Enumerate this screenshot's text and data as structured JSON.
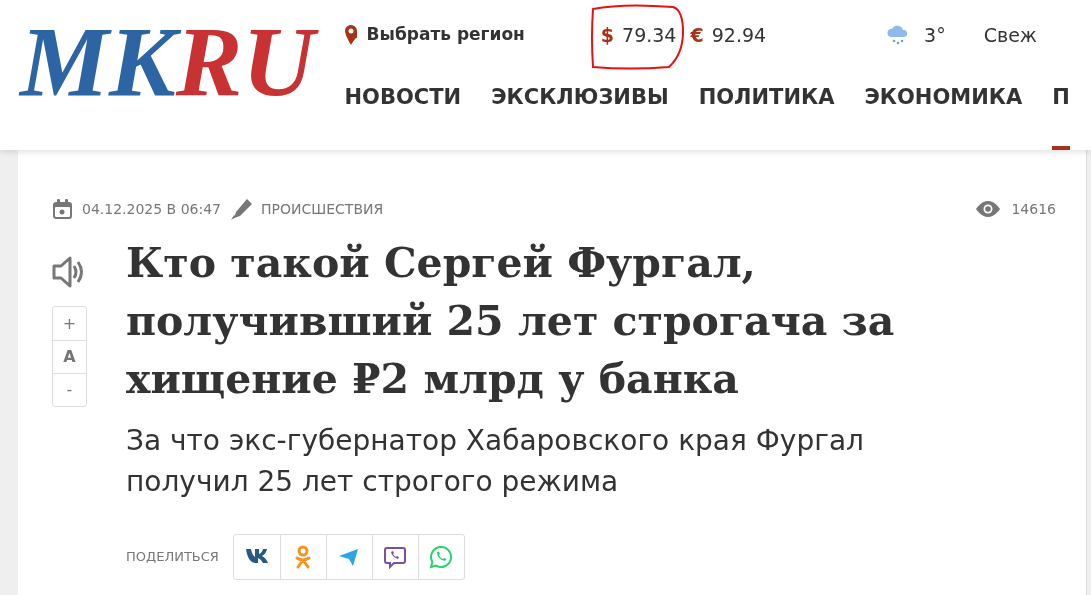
{
  "header": {
    "logo": [
      {
        "text": "MK",
        "color": "#2c64a4"
      },
      {
        "text": "RU",
        "color": "#c83232"
      }
    ],
    "region": "Выбрать регион",
    "currencies": [
      {
        "symbol": "$",
        "value": "79.34",
        "highlighted": true
      },
      {
        "symbol": "€",
        "value": "92.94",
        "highlighted": false
      }
    ],
    "weather": {
      "temperature": "3°"
    },
    "fresh_link": "Свеж",
    "nav": [
      {
        "label": "НОВОСТИ",
        "selected": false
      },
      {
        "label": "ЭКСКЛЮЗИВЫ",
        "selected": false
      },
      {
        "label": "ПОЛИТИКА",
        "selected": false
      },
      {
        "label": "ЭКОНОМИКА",
        "selected": false
      },
      {
        "label": "П",
        "selected": true
      }
    ]
  },
  "article": {
    "date": "04.12.2025 В 06:47",
    "rubric": "ПРОИСШЕСТВИЯ",
    "views": "14616",
    "font_controls": [
      "+",
      "A",
      "-"
    ],
    "title": "Кто такой Сергей Фургал, получивший 25 лет строгача за хищение ₽2 млрд у банка",
    "subtitle": "За что экс-губернатор Хабаровского края Фургал получил 25 лет строгого режима",
    "share_label": "ПОДЕЛИТЬСЯ",
    "share_buttons": [
      {
        "kind": "vk"
      },
      {
        "kind": "ok"
      },
      {
        "kind": "telegram"
      },
      {
        "kind": "viber"
      },
      {
        "kind": "whatsapp"
      }
    ]
  }
}
